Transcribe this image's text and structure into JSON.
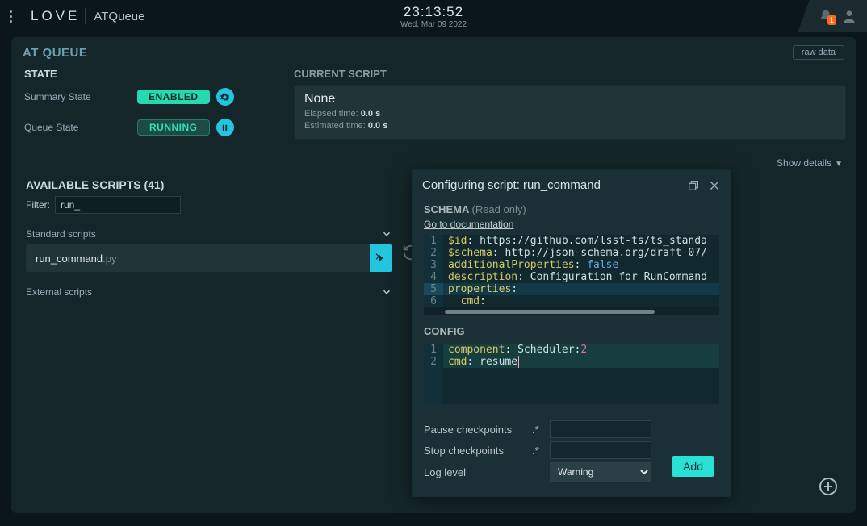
{
  "app": {
    "logo": "LOV",
    "logo_e": "E",
    "subtitle": "ATQueue"
  },
  "clock": {
    "time": "23:13:52",
    "date": "Wed, Mar 09 2022"
  },
  "topright": {
    "notif_count": "1"
  },
  "panel": {
    "title": "AT QUEUE",
    "raw_data": "raw data",
    "show_details": "Show details"
  },
  "state": {
    "heading": "STATE",
    "rows": [
      {
        "label": "Summary State",
        "pill": "ENABLED",
        "kind": "enabled",
        "icon": "gear"
      },
      {
        "label": "Queue State",
        "pill": "RUNNING",
        "kind": "running",
        "icon": "pause"
      }
    ]
  },
  "current": {
    "heading": "CURRENT SCRIPT",
    "name": "None",
    "elapsed_label": "Elapsed time:",
    "elapsed_value": "0.0 s",
    "estimated_label": "Estimated time:",
    "estimated_value": "0.0 s"
  },
  "avail": {
    "heading": "AVAILABLE SCRIPTS (41)",
    "filter_label": "Filter:",
    "filter_value": "run_",
    "groups": [
      {
        "name": "Standard scripts",
        "items": [
          {
            "base": "run_command",
            "ext": ".py"
          }
        ]
      },
      {
        "name": "External scripts",
        "items": []
      }
    ]
  },
  "modal": {
    "title": "Configuring script: run_command",
    "schema_head": "SCHEMA",
    "schema_ro": "(Read only)",
    "doclink": "Go to documentation",
    "schema_lines": [
      {
        "key": "$id",
        "val": "https://github.com/lsst-ts/ts_standa"
      },
      {
        "key": "$schema",
        "val": "http://json-schema.org/draft-07/"
      },
      {
        "key": "additionalProperties",
        "bool": "false"
      },
      {
        "key": "description",
        "val": "Configuration for RunCommand"
      },
      {
        "key": "properties",
        "val": ""
      },
      {
        "indentkey": "cmd",
        "val": ""
      }
    ],
    "config_head": "CONFIG",
    "config_lines": [
      {
        "key": "component",
        "val": "Scheduler:",
        "num": "2"
      },
      {
        "key": "cmd",
        "val": "resume"
      }
    ],
    "pause_label": "Pause checkpoints",
    "stop_label": "Stop checkpoints",
    "dot": ".*",
    "loglevel_label": "Log level",
    "loglevel_value": "Warning",
    "add": "Add"
  }
}
